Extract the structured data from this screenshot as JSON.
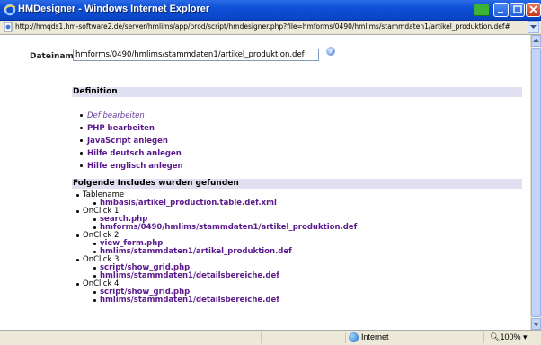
{
  "window": {
    "title": "HMDesigner - Windows Internet Explorer"
  },
  "address": {
    "url": "http://hmqds1.hm-software2.de/server/hmlims/app/prod/script/hmdesigner.php?file=hmforms/0490/hmlims/stammdaten1/artikel_produktion.def#"
  },
  "form": {
    "dateiname_label": "Dateiname:",
    "dateiname_value": "hmforms/0490/hmlims/stammdaten1/artikel_produktion.def",
    "help_glyph": "?"
  },
  "definition": {
    "heading": "Definition",
    "items": [
      {
        "label": "Def bearbeiten"
      },
      {
        "label": "PHP bearbeiten"
      },
      {
        "label": "JavaScript anlegen"
      },
      {
        "label": "Hilfe deutsch anlegen"
      },
      {
        "label": "Hilfe englisch anlegen"
      }
    ]
  },
  "includes": {
    "heading": "Folgende Includes wurden gefunden",
    "groups": [
      {
        "name": "Tablename",
        "files": [
          "hmbasis/artikel_production.table.def.xml"
        ]
      },
      {
        "name": "OnClick 1",
        "files": [
          "search.php",
          "hmforms/0490/hmlims/stammdaten1/artikel_produktion.def"
        ]
      },
      {
        "name": "OnClick 2",
        "files": [
          "view_form.php",
          "hmlims/stammdaten1/artikel_produktion.def"
        ]
      },
      {
        "name": "OnClick 3",
        "files": [
          "script/show_grid.php",
          "hmlims/stammdaten1/detailsbereiche.def"
        ]
      },
      {
        "name": "OnClick 4",
        "files": [
          "script/show_grid.php",
          "hmlims/stammdaten1/detailsbereiche.def"
        ]
      }
    ]
  },
  "status": {
    "zone": "Internet",
    "zoom": "100%"
  }
}
